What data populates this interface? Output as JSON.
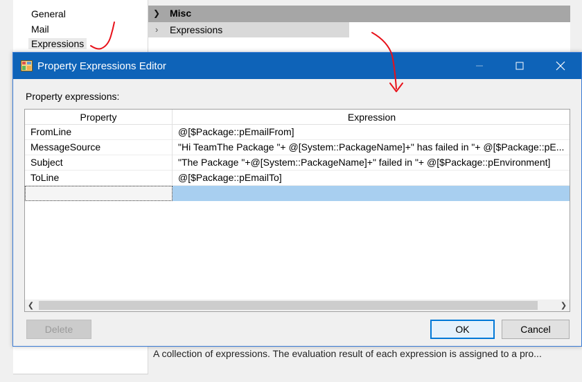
{
  "left_panel": {
    "items": [
      {
        "label": "General"
      },
      {
        "label": "Mail"
      },
      {
        "label": "Expressions"
      }
    ]
  },
  "property_grid": {
    "category": "Misc",
    "row_label": "Expressions"
  },
  "description": {
    "text": "A collection of expressions. The evaluation result of each expression is assigned to a pro..."
  },
  "dialog": {
    "title": "Property Expressions Editor",
    "section_label": "Property expressions:",
    "columns": [
      "Property",
      "Expression"
    ],
    "rows": [
      {
        "property": "FromLine",
        "expression": "@[$Package::pEmailFrom]"
      },
      {
        "property": "MessageSource",
        "expression": "\"Hi TeamThe Package \"+ @[System::PackageName]+\" has failed in \"+ @[$Package::pE..."
      },
      {
        "property": "Subject",
        "expression": "\"The Package \"+@[System::PackageName]+\" failed in \"+ @[$Package::pEnvironment]"
      },
      {
        "property": "ToLine",
        "expression": "@[$Package::pEmailTo]"
      }
    ],
    "buttons": {
      "delete": "Delete",
      "ok": "OK",
      "cancel": "Cancel"
    }
  },
  "colors": {
    "titlebar": "#0e63b8",
    "selection": "#a8cff0",
    "annotation": "#e8111a"
  }
}
